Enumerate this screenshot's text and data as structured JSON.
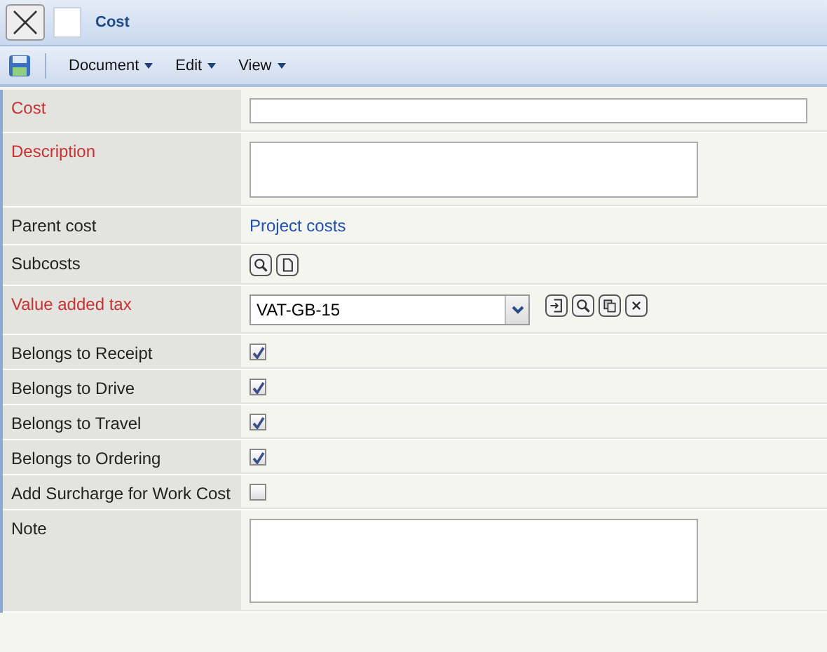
{
  "window": {
    "title": "Cost"
  },
  "toolbar": {
    "menus": [
      {
        "label": "Document"
      },
      {
        "label": "Edit"
      },
      {
        "label": "View"
      }
    ]
  },
  "fields": [
    {
      "label": "Cost",
      "required": true,
      "kind": "text"
    },
    {
      "label": "Description",
      "required": true,
      "kind": "textarea"
    },
    {
      "label": "Parent cost",
      "required": false,
      "kind": "link",
      "value": "Project costs"
    },
    {
      "label": "Subcosts",
      "required": false,
      "kind": "buttons"
    },
    {
      "label": "Value added tax",
      "required": true,
      "kind": "select",
      "value": "VAT-GB-15"
    },
    {
      "label": "Belongs to Receipt",
      "required": false,
      "kind": "checkbox",
      "checked": true
    },
    {
      "label": "Belongs to Drive",
      "required": false,
      "kind": "checkbox",
      "checked": true
    },
    {
      "label": "Belongs to Travel",
      "required": false,
      "kind": "checkbox",
      "checked": true
    },
    {
      "label": "Belongs to Ordering",
      "required": false,
      "kind": "checkbox",
      "checked": true
    },
    {
      "label": "Add Surcharge for Work Cost",
      "required": false,
      "kind": "checkbox",
      "checked": false
    },
    {
      "label": "Note",
      "required": false,
      "kind": "textarea"
    }
  ]
}
